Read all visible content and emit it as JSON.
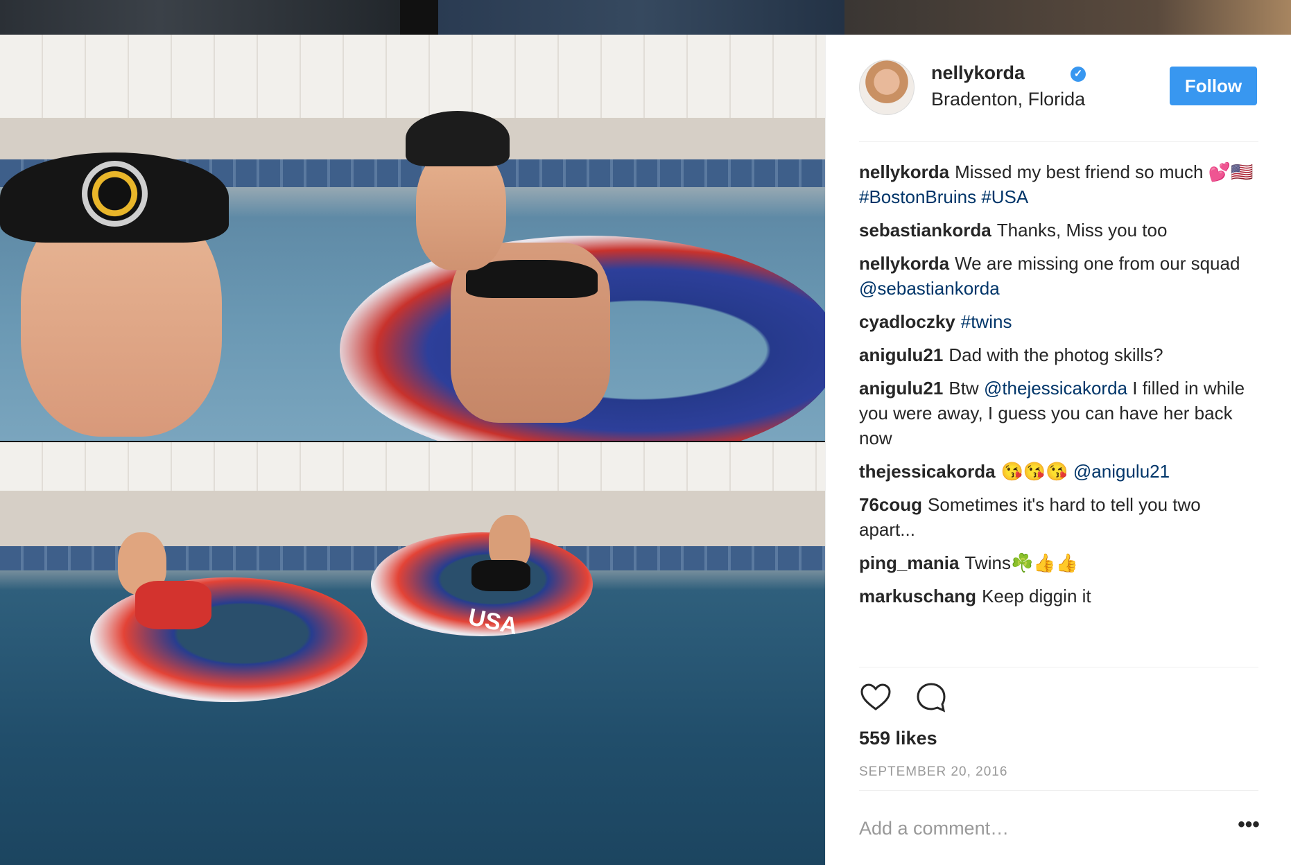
{
  "post": {
    "username": "nellykorda",
    "location": "Bradenton, Florida",
    "follow_label": "Follow",
    "verified_icon": "verified-badge-icon",
    "accent_color": "#3897f0",
    "link_color": "#003569"
  },
  "comments": [
    {
      "user": "nellykorda",
      "text": "Missed my best friend so much 💕🇺🇸 ",
      "tags": "#BostonBruins #USA"
    },
    {
      "user": "sebastiankorda",
      "text": "Thanks, Miss you too",
      "tags": ""
    },
    {
      "user": "nellykorda",
      "text": "We are missing one from our squad ",
      "tags": "@sebastiankorda"
    },
    {
      "user": "cyadloczky",
      "text": "",
      "tags": "#twins"
    },
    {
      "user": "anigulu21",
      "text": "Dad with the photog skills?",
      "tags": ""
    },
    {
      "user": "anigulu21",
      "text": "Btw ",
      "tags": "@thejessicakorda",
      "text_after": " I filled in while you were away, I guess you can have her back now"
    },
    {
      "user": "thejessicakorda",
      "text": "😘😘😘 ",
      "tags": "@anigulu21"
    },
    {
      "user": "76coug",
      "text": "Sometimes it's hard to tell you two apart...",
      "tags": ""
    },
    {
      "user": "ping_mania",
      "text": "Twins☘️👍👍",
      "tags": ""
    },
    {
      "user": "markuschang",
      "text": "Keep diggin it",
      "tags": ""
    }
  ],
  "actions": {
    "like_icon": "heart-icon",
    "comment_icon": "comment-icon",
    "likes": "559 likes",
    "date": "SEPTEMBER 20, 2016",
    "comment_placeholder": "Add a comment…",
    "more_icon": "more-options-icon",
    "more_label": "•••"
  },
  "photo": {
    "tube_text": "USA"
  }
}
